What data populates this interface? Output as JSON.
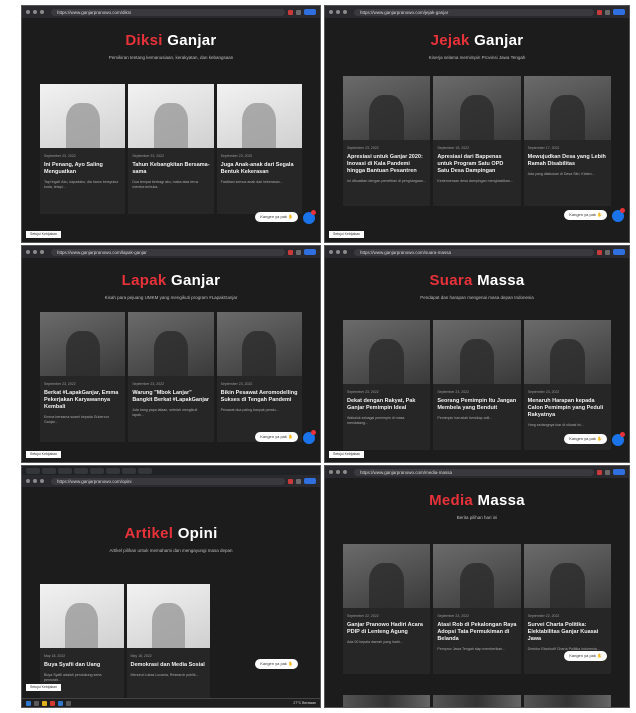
{
  "panels": [
    {
      "url": "https://www.ganjarpranowo.com/diksi",
      "title_highlight": "Diksi",
      "title_rest": "Ganjar",
      "subtitle": "Pemikiran tentang kemanusiaan, kerakyatan, dan kebangsaan",
      "cards": [
        {
          "date": "September 23, 2022",
          "title": "Ini Penang, Ayo Saling Menguatkan",
          "excerpt": "Tapi ingat! Aku, kapadaku, dia harus bersyukur kuda, tetapi..."
        },
        {
          "date": "September 23, 2022",
          "title": "Tahun Kebangkitan Bersama-sama",
          "excerpt": "Dua tempat berbagi aku, maka atas terus mereka terbuka.."
        },
        {
          "date": "September 23, 2022",
          "title": "Juga Anak-anak dari Segala Bentuk Kekerasan",
          "excerpt": "Fasilitasi semua anak dari kekerasan..."
        }
      ],
      "chat_label": "Kangen ya pak",
      "consent": "Setujui Kebijakan"
    },
    {
      "url": "https://www.ganjarpranowo.com/jejak-ganjar",
      "title_highlight": "Jejak",
      "title_rest": "Ganjar",
      "subtitle": "Kinerja selama memimpin Provinsi Jawa Tengah",
      "cards": [
        {
          "date": "September 23, 2022",
          "title": "Apresiasi untuk Ganjar 2020: Inovasi di Kala Pandemi hingga Bantuan Pesantren",
          "excerpt": "Ini dibuatkan dengan penetitian di penghargaan..."
        },
        {
          "date": "September 18, 2022",
          "title": "Apresiasi dari Bappenas untuk Program Satu OPD Satu Desa Dampingan",
          "excerpt": "Kedermeraan desa dampingan menghasilkan..."
        },
        {
          "date": "September 17, 2022",
          "title": "Mewujudkan Desa yang Lebih Ramah Disabilitas",
          "excerpt": "Ada yang dilakukan di Desa Sitri, Klaten..."
        }
      ],
      "chat_label": "Kangen ya pak",
      "consent": "Setujui Kebijakan"
    },
    {
      "url": "https://www.ganjarpranowo.com/lapak-ganjar",
      "title_highlight": "Lapak",
      "title_rest": "Ganjar",
      "subtitle": "Kisah para pejuang UMKM yang mengikuti program #LapakGanjar",
      "cards": [
        {
          "date": "September 23, 2022",
          "title": "Berkat #LapakGanjar, Emma Pekerjakan Karyawannya Kembali",
          "excerpt": "Emma bersama suami kepada Gubernur Ganjar..."
        },
        {
          "date": "September 23, 2022",
          "title": "Warung \"Mbok Lanjar\" Bangkit Berkat #LapakGanjar",
          "excerpt": "Ada hang papa lalaan, setelah mengikuti lapak..."
        },
        {
          "date": "September 23, 2022",
          "title": "Bikin Pesawat Aeromodelling Sukses di Tengah Pandemi",
          "excerpt": "Pesawat dua paling banyak peralu..."
        }
      ],
      "chat_label": "Kangen ya pak",
      "consent": "Setujui Kebijakan"
    },
    {
      "url": "https://www.ganjarpranowo.com/suara-massa",
      "title_highlight": "Suara",
      "title_rest": "Massa",
      "subtitle": "Pendapat dan harapan mengenai masa depan Indonesia",
      "cards": [
        {
          "date": "September 23, 2022",
          "title": "Dekat dengan Rakyat, Pak Ganjar Pemimpin Ideal",
          "excerpt": "Wakaluk sebagai pemimpin di masa mendatang..."
        },
        {
          "date": "September 23, 2022",
          "title": "Seorang Pemimpin Itu Jangan Membela yang Benduit",
          "excerpt": "Pemimpin haruslah bersikap adil..."
        },
        {
          "date": "September 23, 2022",
          "title": "Menaruh Harapan kepada Calon Pemimpin yang Peduli Rakyatnya",
          "excerpt": "Yang sedangnya luar di situasi ini..."
        }
      ],
      "chat_label": "Kangen ya pak",
      "consent": "Setujui Kebijakan"
    },
    {
      "url": "https://www.ganjarpranowo.com/opini",
      "title_highlight": "Artikel",
      "title_rest": "Opini",
      "subtitle": "Artikel pilihan untuk memahami dan mengayungi masa depan",
      "cards": [
        {
          "date": "May 18, 2022",
          "title": "Buya Syafii dan Uang",
          "excerpt": "Buya Syafii adalah pendukung serta pemurah..."
        },
        {
          "date": "May 18, 2022",
          "title": "Demokrasi dan Media Sosial",
          "excerpt": "Menurut Lukas Lucania, Research publik..."
        }
      ],
      "chat_label": "Kangen ya pak",
      "consent": "Setujui Kebijakan",
      "clock": "27°C Berawan"
    },
    {
      "url": "https://www.ganjarpranowo.com/media-massa",
      "title_highlight": "Media",
      "title_rest": "Massa",
      "subtitle": "Berita pilihan hari ini",
      "cards": [
        {
          "date": "September 22, 2022",
          "title": "Ganjar Pranowo Hadiri Acara PDIP di Lenteng Agung",
          "excerpt": "Ada 00 kepala daerah yang hadir..."
        },
        {
          "date": "September 23, 2022",
          "title": "Atasi Rob di Pekalongan Raya Adopsi Tata Permukiman di Belanda",
          "excerpt": "Pemprov Jawa Tengah siap memberikan..."
        },
        {
          "date": "September 22, 2022",
          "title": "Survei Charta Politika: Elektabilitas Ganjar Kuasai Jawa",
          "excerpt": "Direktur Eksekutif Charta Politika Indonesia..."
        }
      ],
      "chat_label": "Kangen ya pak"
    }
  ]
}
